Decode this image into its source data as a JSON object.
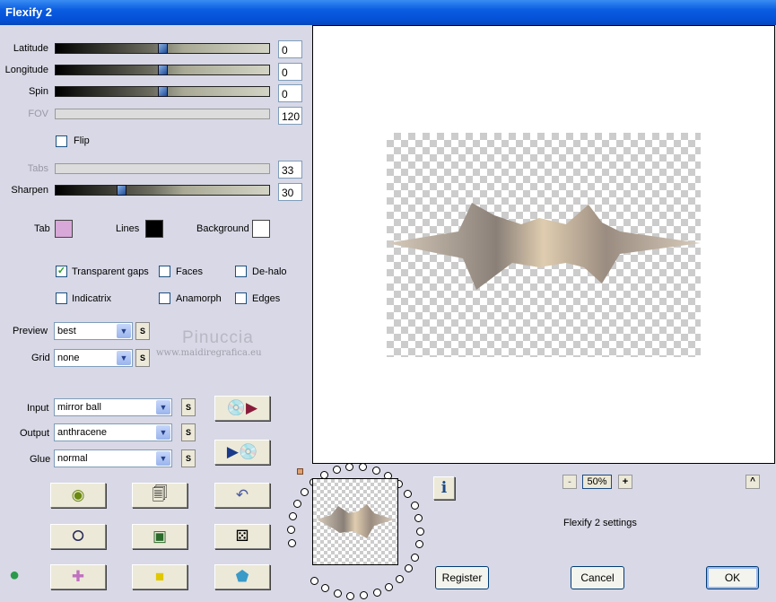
{
  "window": {
    "title": "Flexify 2"
  },
  "sliders": [
    {
      "label": "Latitude",
      "value": "0",
      "position": 0.5,
      "enabled": true
    },
    {
      "label": "Longitude",
      "value": "0",
      "position": 0.5,
      "enabled": true
    },
    {
      "label": "Spin",
      "value": "0",
      "position": 0.5,
      "enabled": true
    },
    {
      "label": "FOV",
      "value": "120",
      "enabled": false
    },
    {
      "label": "Tabs",
      "value": "33",
      "enabled": false
    },
    {
      "label": "Sharpen",
      "value": "30",
      "position": 0.3,
      "enabled": true
    }
  ],
  "flip": {
    "label": "Flip",
    "checked": false
  },
  "colors": {
    "tab_label": "Tab",
    "tab": "#d8a8d8",
    "lines_label": "Lines",
    "lines": "#000000",
    "background_label": "Background",
    "background": "#ffffff"
  },
  "options": [
    {
      "label": "Transparent gaps",
      "checked": true
    },
    {
      "label": "Faces",
      "checked": false
    },
    {
      "label": "De-halo",
      "checked": false
    },
    {
      "label": "Indicatrix",
      "checked": false
    },
    {
      "label": "Anamorph",
      "checked": false
    },
    {
      "label": "Edges",
      "checked": false
    }
  ],
  "preview_select": {
    "label": "Preview",
    "value": "best"
  },
  "grid_select": {
    "label": "Grid",
    "value": "none"
  },
  "input_select": {
    "label": "Input",
    "value": "mirror ball"
  },
  "output_select": {
    "label": "Output",
    "value": "anthracene"
  },
  "glue_select": {
    "label": "Glue",
    "value": "normal"
  },
  "s_label": "S",
  "watermark": {
    "name": "Pinuccia",
    "url": "www.maidiregrafica.eu"
  },
  "zoom": {
    "minus": "-",
    "value": "50%",
    "plus": "+"
  },
  "collapse": "^",
  "info": "i",
  "settings_label": "Flexify 2 settings",
  "buttons": {
    "register": "Register",
    "cancel": "Cancel",
    "ok": "OK"
  },
  "icons": [
    "randomize-globe-icon",
    "copy-icon",
    "undo-icon",
    "ring-icon",
    "square-frame-icon",
    "dice-icon",
    "cross-shape-icon",
    "lego-brick-icon",
    "pentagon-icon"
  ]
}
